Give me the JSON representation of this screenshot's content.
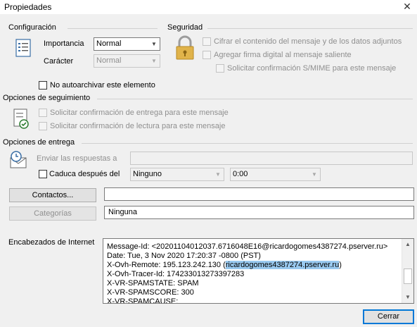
{
  "window": {
    "title": "Propiedades",
    "close": "✕"
  },
  "config": {
    "section": "Configuración",
    "importance_label": "Importancia",
    "importance_value": "Normal",
    "character_label": "Carácter",
    "character_value": "Normal",
    "no_archive": "No autoarchivar este elemento"
  },
  "security": {
    "section": "Seguridad",
    "encrypt": "Cifrar el contenido del mensaje y de los datos adjuntos",
    "sign": "Agregar firma digital al mensaje saliente",
    "smime": "Solicitar confirmación S/MIME para este mensaje"
  },
  "tracking": {
    "section": "Opciones de seguimiento",
    "delivery": "Solicitar confirmación de entrega para este mensaje",
    "read": "Solicitar confirmación de lectura para este mensaje"
  },
  "delivery": {
    "section": "Opciones de entrega",
    "reply_label": "Enviar las respuestas a",
    "reply_value": "",
    "expires_label": "Caduca después del",
    "expires_date": "Ninguno",
    "expires_time": "0:00"
  },
  "contacts": {
    "button": "Contactos...",
    "value": ""
  },
  "categories": {
    "button": "Categorías",
    "value": "Ninguna"
  },
  "headers": {
    "label": "Encabezados de Internet",
    "lines": [
      "Message-Id: <20201104012037.6716048E16@ricardogomes4387274.pserver.ru>",
      "Date: Tue,  3 Nov 2020 17:20:37 -0800 (PST)",
      "X-Ovh-Remote: 195.123.242.130 (",
      "X-Ovh-Tracer-Id: 174233013273397283",
      "X-VR-SPAMSTATE: SPAM",
      "X-VR-SPAMSCORE: 300",
      "X-VR-SPAMCAUSE:"
    ],
    "selected": "ricardogomes4387274.pserver.ru",
    "line3_end": ")"
  },
  "footer": {
    "close_button": "Cerrar"
  }
}
